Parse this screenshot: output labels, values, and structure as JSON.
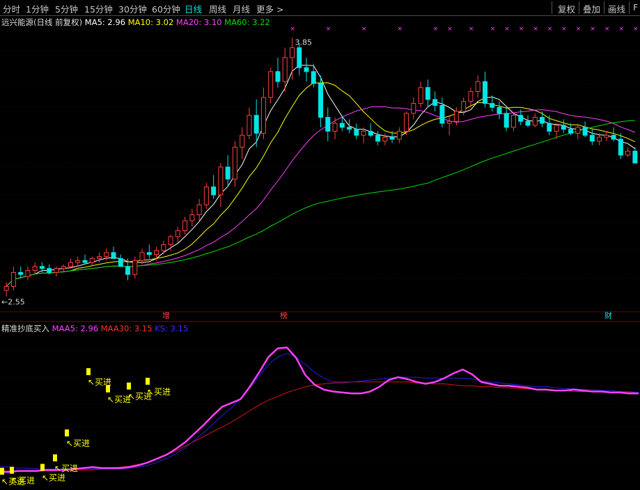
{
  "toolbar": {
    "periods": [
      "分时",
      "1分钟",
      "5分钟",
      "15分钟",
      "30分钟",
      "60分钟",
      "日线",
      "周线",
      "月线",
      "更多"
    ],
    "active_period": "日线",
    "more_arrow": ">",
    "right_buttons": [
      "复权",
      "叠加",
      "画线",
      "F"
    ]
  },
  "main_chart": {
    "title": "远兴能源(日线 前复权)",
    "ma_values": [
      {
        "label": "MA5: 2.96",
        "color": "#ffffff"
      },
      {
        "label": "MA10: 3.02",
        "color": "#ffff00"
      },
      {
        "label": "MA20: 3.10",
        "color": "#ff40ff"
      },
      {
        "label": "MA60: 3.22",
        "color": "#00e000"
      }
    ],
    "high_label": "3.85",
    "low_label": "2.55",
    "event_markers": [
      "增",
      "榜",
      "财"
    ],
    "colors": {
      "up": "#ff4040",
      "down": "#00e5e5",
      "ma5": "#ffffff",
      "ma10": "#ffff00",
      "ma20": "#ff40ff",
      "ma60": "#00e000",
      "marker": "#ff40ff"
    }
  },
  "sub_chart": {
    "title": "精准抄底买入",
    "values": [
      {
        "label": "MAA5: 2.96",
        "color": "#ff40ff"
      },
      {
        "label": "MAA30: 3.15",
        "color": "#ff3030"
      },
      {
        "label": "KS: 3.15",
        "color": "#3030ff"
      }
    ],
    "signal_label": "买进",
    "colors": {
      "maa5": "#ff40ff",
      "maa30": "#e01010",
      "ks": "#2020e0",
      "signal": "#ffff00"
    }
  },
  "chart_data": {
    "type": "candlestick",
    "ohlc": [
      [
        2.58,
        2.62,
        2.55,
        2.6
      ],
      [
        2.6,
        2.7,
        2.58,
        2.67
      ],
      [
        2.67,
        2.7,
        2.64,
        2.66
      ],
      [
        2.65,
        2.7,
        2.63,
        2.68
      ],
      [
        2.68,
        2.72,
        2.66,
        2.7
      ],
      [
        2.7,
        2.72,
        2.67,
        2.69
      ],
      [
        2.69,
        2.71,
        2.66,
        2.67
      ],
      [
        2.67,
        2.7,
        2.65,
        2.69
      ],
      [
        2.69,
        2.71,
        2.67,
        2.7
      ],
      [
        2.7,
        2.74,
        2.69,
        2.72
      ],
      [
        2.72,
        2.75,
        2.7,
        2.73
      ],
      [
        2.73,
        2.76,
        2.71,
        2.72
      ],
      [
        2.72,
        2.75,
        2.7,
        2.74
      ],
      [
        2.74,
        2.77,
        2.72,
        2.75
      ],
      [
        2.75,
        2.79,
        2.73,
        2.77
      ],
      [
        2.77,
        2.8,
        2.75,
        2.74
      ],
      [
        2.74,
        2.76,
        2.71,
        2.7
      ],
      [
        2.7,
        2.74,
        2.63,
        2.66
      ],
      [
        2.66,
        2.75,
        2.64,
        2.73
      ],
      [
        2.73,
        2.79,
        2.71,
        2.77
      ],
      [
        2.77,
        2.81,
        2.74,
        2.76
      ],
      [
        2.76,
        2.8,
        2.73,
        2.78
      ],
      [
        2.78,
        2.83,
        2.76,
        2.81
      ],
      [
        2.81,
        2.86,
        2.78,
        2.85
      ],
      [
        2.85,
        2.9,
        2.82,
        2.88
      ],
      [
        2.88,
        2.95,
        2.86,
        2.93
      ],
      [
        2.93,
        2.99,
        2.9,
        2.96
      ],
      [
        2.96,
        3.04,
        2.93,
        3.01
      ],
      [
        3.01,
        3.12,
        2.99,
        3.1
      ],
      [
        3.1,
        3.16,
        3.04,
        3.06
      ],
      [
        3.06,
        3.22,
        3.0,
        3.2
      ],
      [
        3.2,
        3.26,
        3.1,
        3.14
      ],
      [
        3.14,
        3.33,
        3.1,
        3.3
      ],
      [
        3.3,
        3.4,
        3.24,
        3.36
      ],
      [
        3.36,
        3.5,
        3.34,
        3.46
      ],
      [
        3.46,
        3.54,
        3.3,
        3.37
      ],
      [
        3.37,
        3.6,
        3.34,
        3.55
      ],
      [
        3.55,
        3.7,
        3.52,
        3.68
      ],
      [
        3.68,
        3.75,
        3.6,
        3.63
      ],
      [
        3.63,
        3.8,
        3.58,
        3.75
      ],
      [
        3.75,
        3.85,
        3.64,
        3.8
      ],
      [
        3.8,
        3.82,
        3.66,
        3.7
      ],
      [
        3.7,
        3.75,
        3.63,
        3.68
      ],
      [
        3.68,
        3.72,
        3.6,
        3.62
      ],
      [
        3.62,
        3.66,
        3.4,
        3.45
      ],
      [
        3.45,
        3.5,
        3.33,
        3.38
      ],
      [
        3.38,
        3.45,
        3.34,
        3.42
      ],
      [
        3.42,
        3.46,
        3.38,
        3.4
      ],
      [
        3.4,
        3.44,
        3.37,
        3.39
      ],
      [
        3.39,
        3.42,
        3.34,
        3.36
      ],
      [
        3.36,
        3.4,
        3.32,
        3.38
      ],
      [
        3.38,
        3.42,
        3.35,
        3.36
      ],
      [
        3.36,
        3.38,
        3.31,
        3.33
      ],
      [
        3.33,
        3.37,
        3.31,
        3.35
      ],
      [
        3.35,
        3.38,
        3.32,
        3.34
      ],
      [
        3.34,
        3.4,
        3.32,
        3.38
      ],
      [
        3.38,
        3.48,
        3.36,
        3.47
      ],
      [
        3.47,
        3.55,
        3.44,
        3.52
      ],
      [
        3.52,
        3.63,
        3.5,
        3.6
      ],
      [
        3.6,
        3.64,
        3.5,
        3.54
      ],
      [
        3.54,
        3.58,
        3.48,
        3.51
      ],
      [
        3.51,
        3.55,
        3.4,
        3.42
      ],
      [
        3.42,
        3.46,
        3.36,
        3.43
      ],
      [
        3.43,
        3.5,
        3.41,
        3.48
      ],
      [
        3.48,
        3.55,
        3.46,
        3.53
      ],
      [
        3.53,
        3.6,
        3.5,
        3.58
      ],
      [
        3.58,
        3.66,
        3.55,
        3.63
      ],
      [
        3.63,
        3.68,
        3.5,
        3.52
      ],
      [
        3.52,
        3.56,
        3.48,
        3.5
      ],
      [
        3.5,
        3.53,
        3.44,
        3.47
      ],
      [
        3.47,
        3.5,
        3.38,
        3.4
      ],
      [
        3.4,
        3.47,
        3.38,
        3.46
      ],
      [
        3.46,
        3.49,
        3.41,
        3.43
      ],
      [
        3.43,
        3.46,
        3.4,
        3.41
      ],
      [
        3.41,
        3.47,
        3.4,
        3.45
      ],
      [
        3.45,
        3.48,
        3.4,
        3.42
      ],
      [
        3.42,
        3.46,
        3.36,
        3.38
      ],
      [
        3.38,
        3.42,
        3.34,
        3.41
      ],
      [
        3.41,
        3.44,
        3.37,
        3.39
      ],
      [
        3.39,
        3.42,
        3.36,
        3.37
      ],
      [
        3.37,
        3.41,
        3.34,
        3.4
      ],
      [
        3.4,
        3.43,
        3.35,
        3.36
      ],
      [
        3.36,
        3.39,
        3.31,
        3.33
      ],
      [
        3.33,
        3.37,
        3.31,
        3.35
      ],
      [
        3.35,
        3.38,
        3.33,
        3.36
      ],
      [
        3.36,
        3.4,
        3.33,
        3.34
      ],
      [
        3.34,
        3.37,
        3.24,
        3.26
      ],
      [
        3.26,
        3.3,
        3.25,
        3.28
      ],
      [
        3.28,
        3.3,
        3.22,
        3.22
      ]
    ],
    "ylim": [
      2.5,
      3.9
    ],
    "y_labels": [
      "3.85",
      "2.55"
    ],
    "sub_ylim": [
      2.5,
      4.1
    ],
    "maa5": [
      2.66,
      2.66,
      2.67,
      2.67,
      2.67,
      2.68,
      2.68,
      2.68,
      2.69,
      2.7,
      2.71,
      2.7,
      2.7,
      2.7,
      2.71,
      2.73,
      2.76,
      2.8,
      2.84,
      2.9,
      2.97,
      3.06,
      3.15,
      3.25,
      3.34,
      3.38,
      3.42,
      3.55,
      3.7,
      3.86,
      3.95,
      3.96,
      3.85,
      3.67,
      3.57,
      3.52,
      3.5,
      3.49,
      3.48,
      3.48,
      3.5,
      3.55,
      3.62,
      3.65,
      3.63,
      3.6,
      3.58,
      3.6,
      3.64,
      3.69,
      3.73,
      3.68,
      3.6,
      3.58,
      3.56,
      3.56,
      3.55,
      3.54,
      3.52,
      3.52,
      3.51,
      3.51,
      3.52,
      3.51,
      3.5,
      3.5,
      3.49,
      3.49,
      3.48,
      3.48
    ],
    "maa30": [
      2.67,
      2.67,
      2.67,
      2.67,
      2.67,
      2.67,
      2.67,
      2.68,
      2.68,
      2.68,
      2.68,
      2.69,
      2.7,
      2.71,
      2.72,
      2.74,
      2.76,
      2.8,
      2.84,
      2.88,
      2.93,
      2.98,
      3.03,
      3.08,
      3.13,
      3.18,
      3.24,
      3.3,
      3.36,
      3.41,
      3.45,
      3.49,
      3.52,
      3.55,
      3.57,
      3.58,
      3.59,
      3.59,
      3.6,
      3.6,
      3.6,
      3.6,
      3.6,
      3.6,
      3.6,
      3.59,
      3.59,
      3.58,
      3.58,
      3.57,
      3.56,
      3.56,
      3.55,
      3.55,
      3.54,
      3.54,
      3.53,
      3.53,
      3.52,
      3.52,
      3.51,
      3.51,
      3.5,
      3.5,
      3.5,
      3.5,
      3.49,
      3.49,
      3.49,
      3.49
    ],
    "ks": [
      2.72,
      2.71,
      2.7,
      2.7,
      2.69,
      2.69,
      2.69,
      2.69,
      2.69,
      2.69,
      2.69,
      2.69,
      2.69,
      2.69,
      2.7,
      2.71,
      2.73,
      2.76,
      2.8,
      2.85,
      2.91,
      2.99,
      3.07,
      3.16,
      3.25,
      3.33,
      3.43,
      3.54,
      3.66,
      3.78,
      3.86,
      3.9,
      3.86,
      3.78,
      3.7,
      3.64,
      3.6,
      3.6,
      3.6,
      3.61,
      3.62,
      3.63,
      3.64,
      3.65,
      3.65,
      3.65,
      3.64,
      3.64,
      3.64,
      3.64,
      3.64,
      3.63,
      3.61,
      3.6,
      3.59,
      3.58,
      3.57,
      3.56,
      3.55,
      3.55,
      3.54,
      3.53,
      3.53,
      3.52,
      3.52,
      3.51,
      3.51,
      3.5,
      3.5,
      3.49
    ],
    "signals": [
      0,
      14,
      58,
      76,
      93,
      124,
      152,
      182,
      209
    ]
  }
}
